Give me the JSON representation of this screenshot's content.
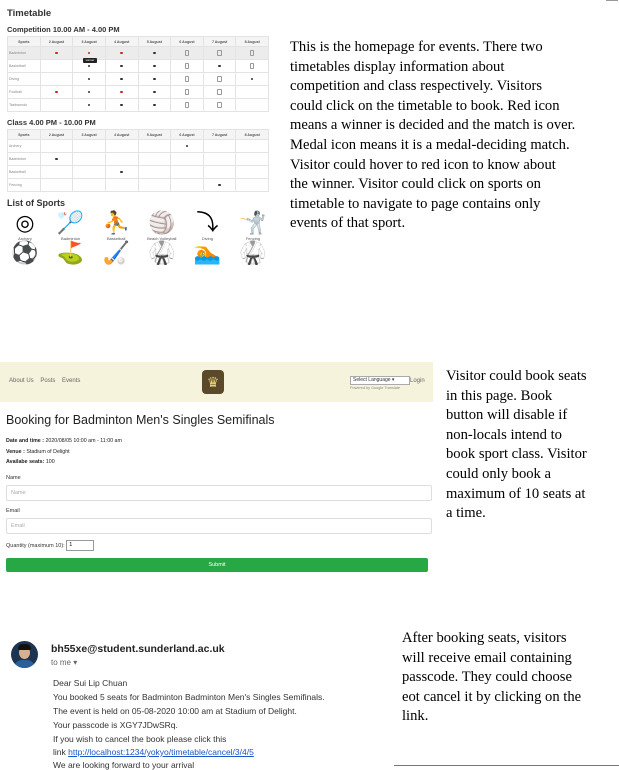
{
  "timetable": {
    "title": "Timetable",
    "competition_heading": "Competition 10.00 AM - 4.00 PM",
    "class_heading": "Class 4.00 PM - 10.00 PM",
    "columns": [
      "Sports",
      "2 August",
      "3 August",
      "4 August",
      "5 August",
      "6 August",
      "7 August",
      "8 August"
    ],
    "tooltip": "winner",
    "competition_rows": [
      {
        "sport": "Badminton",
        "cells": [
          "red",
          "red",
          "red",
          "dot",
          "medal",
          "medal",
          "medal"
        ]
      },
      {
        "sport": "Basketball",
        "cells": [
          "",
          "dot",
          "dot",
          "dot",
          "medal",
          "dot",
          "medal"
        ]
      },
      {
        "sport": "Diving",
        "cells": [
          "",
          "dot",
          "dot",
          "dot",
          "medal",
          "medal",
          "dot"
        ]
      },
      {
        "sport": "Football",
        "cells": [
          "red",
          "dot",
          "red",
          "dot",
          "medal",
          "medal",
          ""
        ]
      },
      {
        "sport": "Taekwondo",
        "cells": [
          "",
          "dot",
          "dot",
          "dot",
          "medal",
          "medal",
          ""
        ]
      }
    ],
    "class_rows": [
      {
        "sport": "Archery",
        "cells": [
          "",
          "",
          "",
          "",
          "dot",
          "",
          ""
        ]
      },
      {
        "sport": "Badminton",
        "cells": [
          "dot",
          "",
          "",
          "",
          "",
          "",
          ""
        ]
      },
      {
        "sport": "Basketball",
        "cells": [
          "",
          "",
          "dot",
          "",
          "",
          "",
          ""
        ]
      },
      {
        "sport": "Fencing",
        "cells": [
          "",
          "",
          "",
          "",
          "",
          "dot",
          ""
        ]
      }
    ],
    "list_heading": "List of Sports",
    "sports_icons": [
      {
        "icon": "archery-icon",
        "glyph": "◎",
        "label": "Archery"
      },
      {
        "icon": "badminton-icon",
        "glyph": "🏸",
        "label": "Badminton"
      },
      {
        "icon": "basketball-icon",
        "glyph": "⛹",
        "label": "Basketball"
      },
      {
        "icon": "volleyball-icon",
        "glyph": "🏐",
        "label": "Beach Volleyball"
      },
      {
        "icon": "diving-icon",
        "glyph": "⤵",
        "label": "Diving"
      },
      {
        "icon": "fencing-icon",
        "glyph": "🤺",
        "label": "Fencing"
      }
    ],
    "sports_icons_row2": [
      {
        "icon": "football-icon",
        "glyph": "⚽"
      },
      {
        "icon": "golf-icon",
        "glyph": "⛳"
      },
      {
        "icon": "hockey-icon",
        "glyph": "🏑"
      },
      {
        "icon": "martial-arts-icon",
        "glyph": "🥋"
      },
      {
        "icon": "swimming-icon",
        "glyph": "🏊"
      },
      {
        "icon": "taekwondo-icon",
        "glyph": "🥋"
      }
    ]
  },
  "descriptions": {
    "homepage": [
      "This is the homepage for events. There two",
      "timetables display information about",
      "competition and class respectively. Visitors",
      "could click on the timetable to book. Red icon",
      "means a winner is decided and the match is over.",
      "Medal icon means it is a medal-deciding match.",
      "Visitor could hover to red icon to know about",
      "the winner. Visitor could click on sports on",
      "timetable to navigate to page contains only",
      "events of that sport."
    ],
    "booking": [
      "Visitor could book seats",
      "in this page. Book",
      "button will disable if",
      "non-locals intend to",
      "book sport class. Visitor",
      "could only book a",
      "maximum of 10 seats at",
      "a time."
    ],
    "email": [
      "After booking seats,  visitors",
      "will receive email containing",
      "passcode. They could choose",
      "eot cancel it by clicking on the",
      "link."
    ]
  },
  "booking_page": {
    "nav_links": [
      "About Us",
      "Posts",
      "Events"
    ],
    "language_select": "Select Language",
    "powered_by": "Powered by Google Translate",
    "login": "Login",
    "heading": "Booking for Badminton Men's Singles Semifinals",
    "datetime_label": "Date and time :",
    "datetime_value": "2020/08/05 10:00 am - 11:00 am",
    "venue_label": "Venue :",
    "venue_value": "Stadium of Delight",
    "seats_label": "Availabe seats:",
    "seats_value": "100",
    "name_label": "Name",
    "name_placeholder": "Name",
    "email_label": "Email",
    "email_placeholder": "Email",
    "quantity_label": "Quantity (maximum 10):",
    "quantity_value": "1",
    "submit_label": "Submit"
  },
  "email": {
    "sender": "bh55xe@student.sunderland.ac.uk",
    "to": "to me ▾",
    "greeting": "Dear  Sui Lip Chuan",
    "line1": "You booked 5 seats for Badminton Badminton Men's Singles Semifinals.",
    "line2": "The event is held on 05-08-2020 10:00 am at Stadium of Delight.",
    "line3": "Your passcode is XGY7JDwSRq.",
    "line4": "If you wish to cancel the book please click this",
    "link_prefix": "link ",
    "link": "http://localhost:1234/yokyo/timetable/cancel/3/4/5",
    "line5": "We are looking forward to your arrival"
  }
}
